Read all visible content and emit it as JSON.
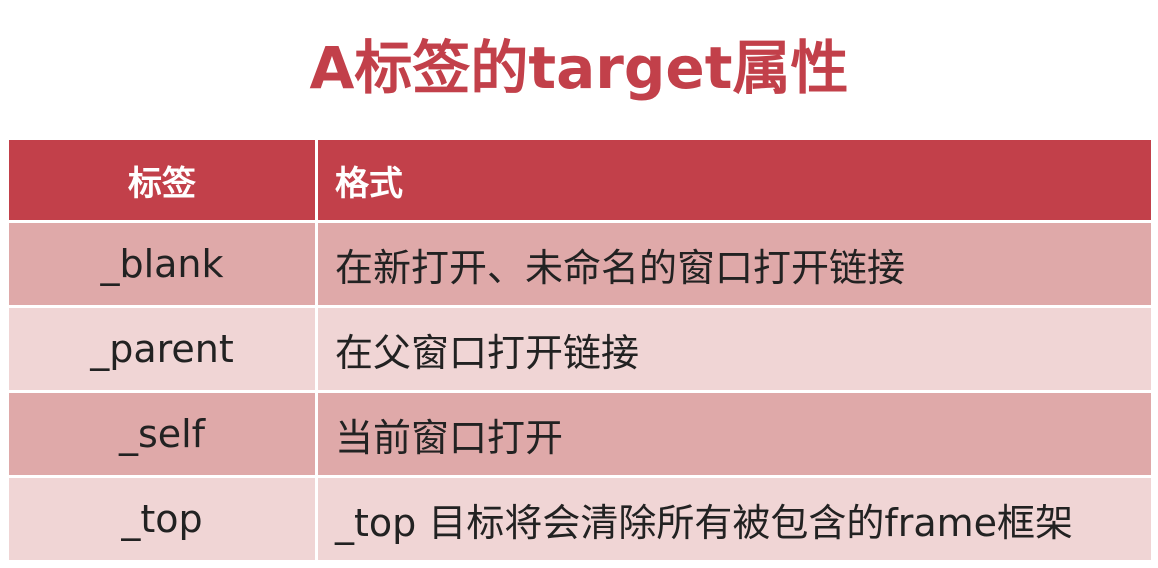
{
  "slide": {
    "title": "A标签的target属性"
  },
  "table": {
    "headers": {
      "tag": "标签",
      "format": "格式"
    },
    "rows": [
      {
        "tag": "_blank",
        "desc": "在新打开、未命名的窗口打开链接"
      },
      {
        "tag": "_parent",
        "desc": "在父窗口打开链接"
      },
      {
        "tag": "_self",
        "desc": "当前窗口打开"
      },
      {
        "tag": "_top",
        "desc": " _top 目标将会清除所有被包含的frame框架"
      }
    ]
  },
  "colors": {
    "accent": "#c2404a",
    "row_dark": "#dfa9a9",
    "row_light": "#f0d5d5"
  }
}
